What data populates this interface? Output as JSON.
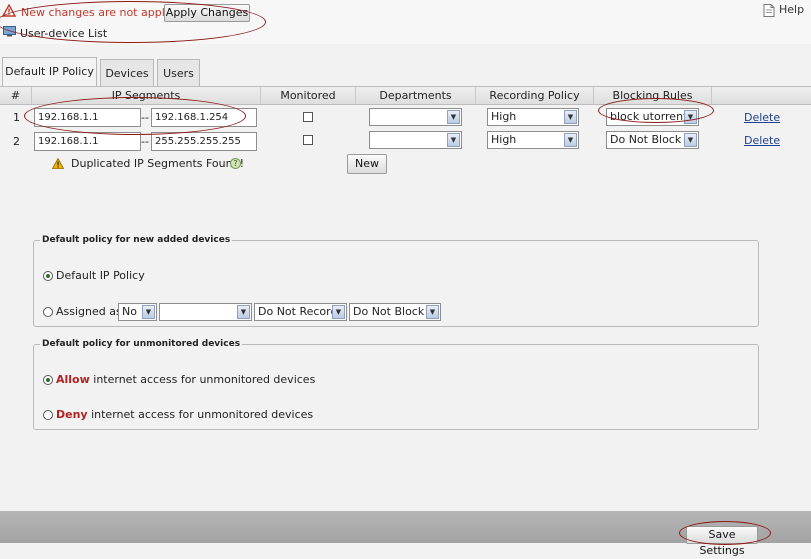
{
  "top": {
    "warning_text": "New changes are not applied:",
    "apply_label": "Apply Changes",
    "help_label": "Help",
    "list_label": "User-device List"
  },
  "tabs": [
    {
      "label": "Default IP Policy",
      "active": true
    },
    {
      "label": "Devices",
      "active": false
    },
    {
      "label": "Users",
      "active": false
    }
  ],
  "table": {
    "columns": [
      "#",
      "IP Segments",
      "Monitored",
      "Departments",
      "Recording Policy",
      "Blocking Rules"
    ],
    "rows": [
      {
        "num": "1",
        "ip_from": "192.168.1.1",
        "sep": "--",
        "ip_to": "192.168.1.254",
        "monitored": false,
        "department": "",
        "recording": "High",
        "blocking": "block utorrent",
        "action": "Delete"
      },
      {
        "num": "2",
        "ip_from": "192.168.1.1",
        "sep": "--",
        "ip_to": "255.255.255.255",
        "monitored": false,
        "department": "",
        "recording": "High",
        "blocking": "Do Not Block",
        "action": "Delete"
      }
    ],
    "duplicate_warning": "Duplicated IP Segments Found!",
    "help_glyph": "?",
    "new_label": "New"
  },
  "new_devices": {
    "legend": "Default policy for new added devices",
    "option_default": "Default IP Policy",
    "option_assigned": "Assigned as:",
    "selected": "default",
    "assigned_monitor": "No",
    "assigned_department": "",
    "assigned_record": "Do Not Record",
    "assigned_block": "Do Not Block"
  },
  "unmonitored": {
    "legend": "Default policy for unmonitored devices",
    "allow_word": "Allow",
    "allow_rest": " internet access for unmonitored devices",
    "deny_word": "Deny",
    "deny_rest": " internet access for unmonitored devices",
    "selected": "allow"
  },
  "footer": {
    "save_label": "Save Settings"
  },
  "colors": {
    "warning": "#c0392b",
    "link": "#1f3f8f",
    "annotation": "#8b1a1a",
    "allow_deny": "#b22222"
  }
}
